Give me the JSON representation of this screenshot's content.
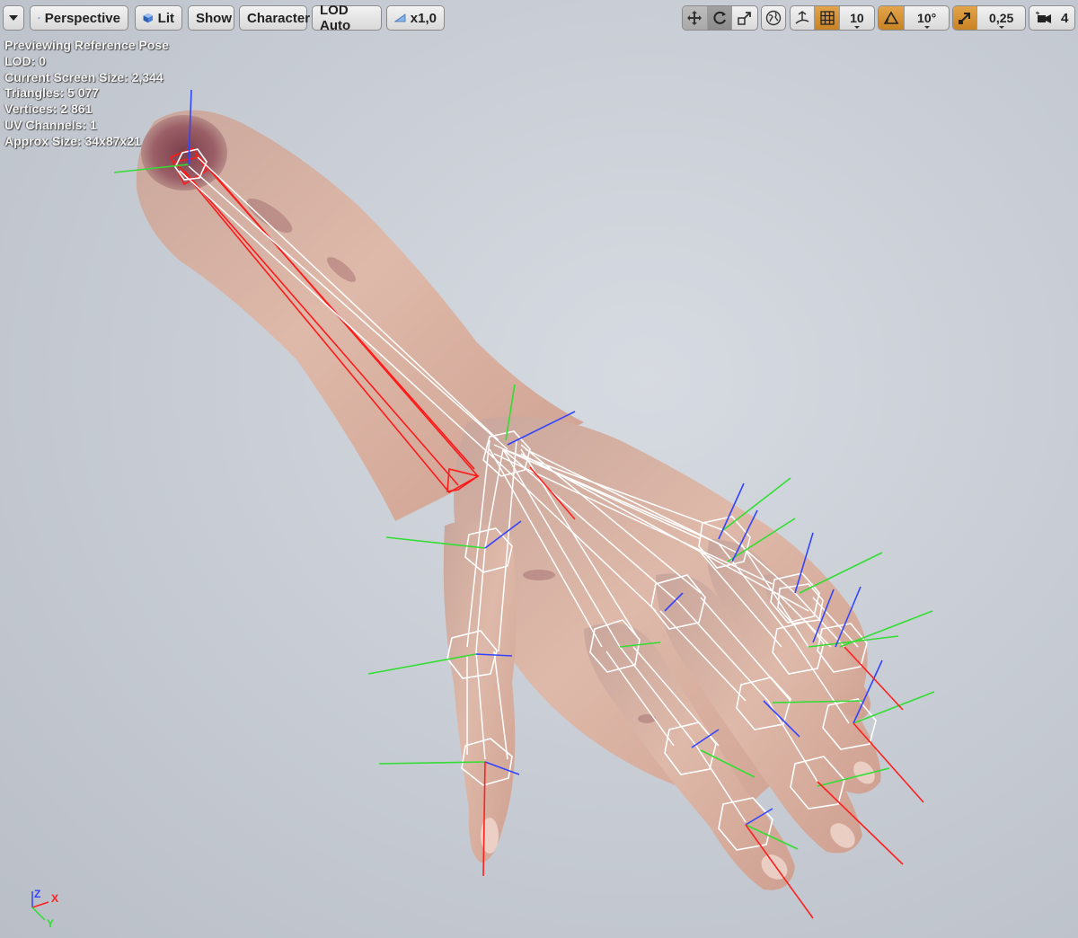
{
  "toolbar": {
    "menu_icon": "chevron-down-icon",
    "view_mode": {
      "icon": "perspective-plane-icon",
      "label": "Perspective"
    },
    "lighting": {
      "icon": "lit-cube-icon",
      "label": "Lit"
    },
    "show_label": "Show",
    "character_label": "Character",
    "lod_label": "LOD Auto",
    "speed": {
      "icon": "play-speed-icon",
      "label": "x1,0"
    },
    "transform_tools": [
      "translate-icon",
      "rotate-icon",
      "scale-icon"
    ],
    "coord_space_icon": "world-globe-icon",
    "surface_snap_icon": "surface-snap-icon",
    "grid_snap": {
      "icon": "grid-icon",
      "value": "10"
    },
    "rotation_snap": {
      "icon": "angle-icon",
      "value": "10°"
    },
    "scale_snap": {
      "icon": "scale-arrow-icon",
      "value": "0,25"
    },
    "camera_speed": {
      "icon": "camera-icon",
      "value": "4"
    },
    "accent_color": "#c98324"
  },
  "stats": {
    "preview_mode": "Previewing Reference Pose",
    "lod": "LOD: 0",
    "screen_size": "Current Screen Size: 2,344",
    "triangles": "Triangles: 5 077",
    "vertices": "Vertices: 2 861",
    "uv_channels": "UV Channels: 1",
    "approx_size": "Approx Size: 34x87x21"
  },
  "axis_indicator": {
    "z": "Z",
    "x": "X",
    "y": "Y"
  },
  "colors": {
    "bone_selected": "#ff1a1a",
    "bone": "#ffffff",
    "axis_x": "#ff2020",
    "axis_y": "#33dd33",
    "axis_z": "#3344ff"
  }
}
